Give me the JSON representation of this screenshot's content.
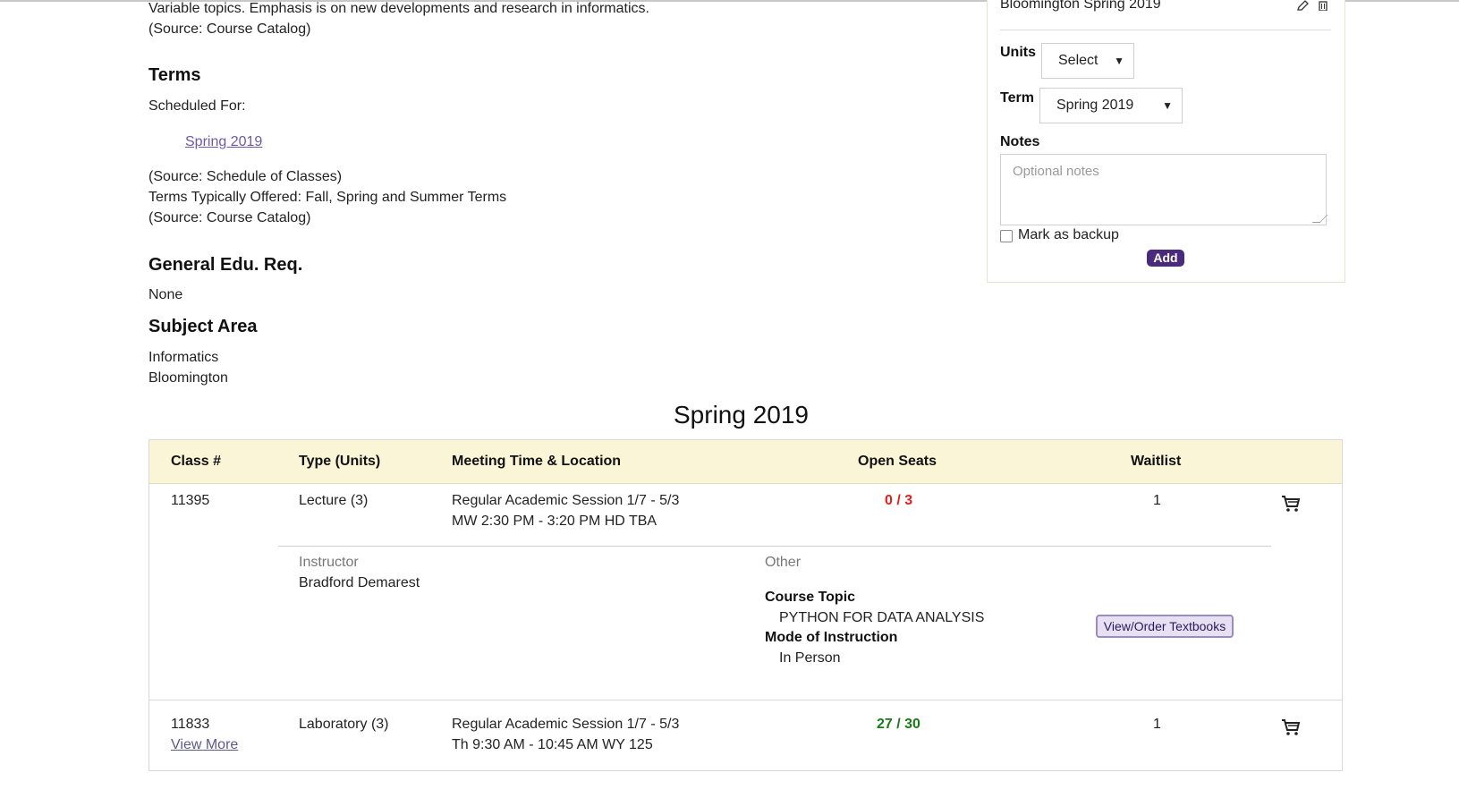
{
  "description": {
    "line1": "Variable topics. Emphasis is on new developments and research in informatics.",
    "line2": "(Source: Course Catalog)"
  },
  "terms": {
    "heading": "Terms",
    "scheduled_label": "Scheduled For:",
    "scheduled_term": "Spring 2019",
    "source1": "(Source: Schedule of Classes)",
    "typically": "Terms Typically Offered: Fall, Spring and Summer Terms",
    "source2": "(Source: Course Catalog)"
  },
  "gened": {
    "heading": "General Edu. Req.",
    "value": "None"
  },
  "subject": {
    "heading": "Subject Area",
    "line1": "Informatics",
    "line2": "Bloomington"
  },
  "panel": {
    "top_item": "Bloomington Spring 2019",
    "units_label": "Units",
    "units_value": "Select",
    "term_label": "Term",
    "term_value": "Spring 2019",
    "notes_label": "Notes",
    "notes_placeholder": "Optional notes",
    "backup_label": "Mark as backup",
    "add_label": "Add"
  },
  "schedule": {
    "title": "Spring 2019",
    "headers": [
      "Class #",
      "Type (Units)",
      "Meeting Time & Location",
      "Open Seats",
      "Waitlist"
    ],
    "rows": [
      {
        "class_num": "11395",
        "type": "Lecture (3)",
        "meeting1": "Regular Academic Session 1/7 - 5/3",
        "meeting2": "MW 2:30 PM - 3:20 PM HD TBA",
        "seats": "0 / 3",
        "waitlist": "1",
        "instructor_label": "Instructor",
        "instructor": "Bradford Demarest",
        "other_label": "Other",
        "topic_label": "Course Topic",
        "topic": "PYTHON FOR DATA ANALYSIS",
        "mode_label": "Mode of Instruction",
        "mode": "In Person",
        "textbook_btn": "View/Order Textbooks"
      },
      {
        "class_num": "11833",
        "view_more": "View More",
        "type": "Laboratory (3)",
        "meeting1": "Regular Academic Session 1/7 - 5/3",
        "meeting2": "Th 9:30 AM - 10:45 AM WY 125",
        "seats": "27 / 30",
        "waitlist": "1"
      }
    ]
  },
  "colors": {
    "accent": "#4a2a7a",
    "header_bg": "#fbf5d8",
    "closed": "#e02020",
    "open": "#1a7a1a"
  },
  "icons": [
    "pencil-icon",
    "trash-icon",
    "cart-icon"
  ]
}
